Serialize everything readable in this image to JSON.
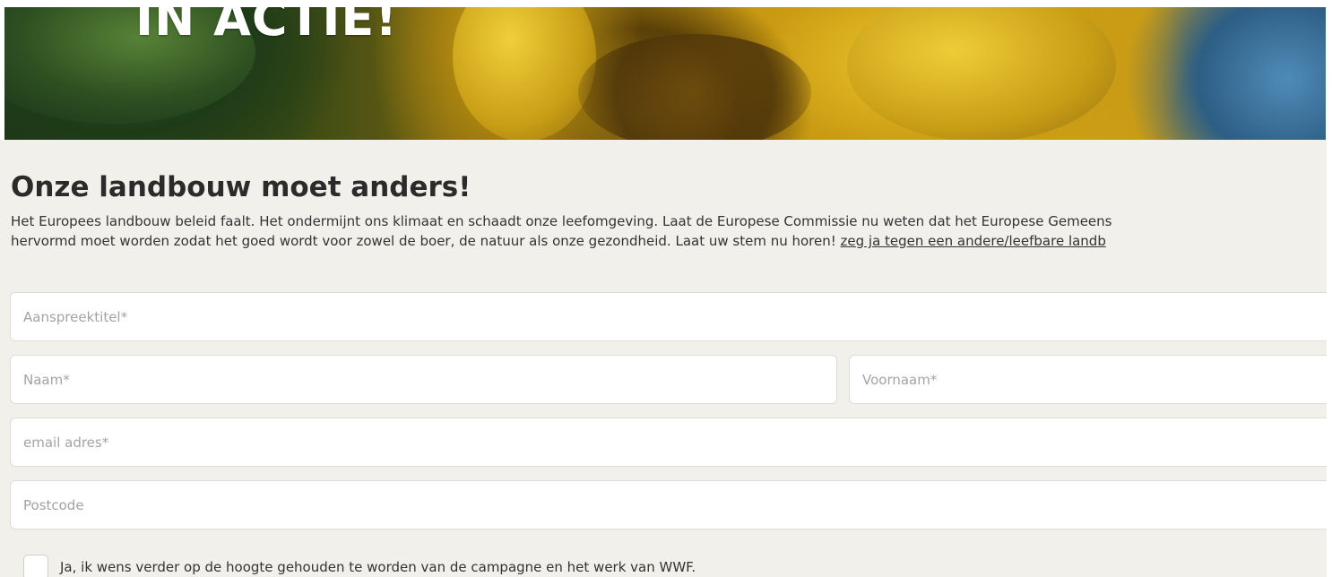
{
  "hero": {
    "title": "IN ACTIE!"
  },
  "campaign": {
    "heading": "Onze landbouw moet anders!",
    "intro_line1": "Het Europees landbouw beleid faalt. Het ondermijnt ons klimaat en schaadt onze leefomgeving. Laat de Europese Commissie nu weten dat het Europese Gemeens",
    "intro_line2": "hervormd moet worden zodat het goed wordt voor zowel de boer, de natuur als onze gezondheid. Laat uw stem nu horen! ",
    "intro_link": "zeg ja tegen een andere/leefbare landb"
  },
  "form": {
    "salutation_placeholder": "Aanspreektitel*",
    "lastname_placeholder": "Naam*",
    "firstname_placeholder": "Voornaam*",
    "email_placeholder": "email adres*",
    "postcode_placeholder": "Postcode",
    "optin_label": "Ja, ik wens verder op de hoogte gehouden te worden van de campagne en het werk van WWF."
  },
  "colors": {
    "page_background": "#f1f0ea",
    "heading_text": "#2b2b2b",
    "field_border": "#dcdcd6",
    "placeholder_text": "#a3a3a3"
  }
}
